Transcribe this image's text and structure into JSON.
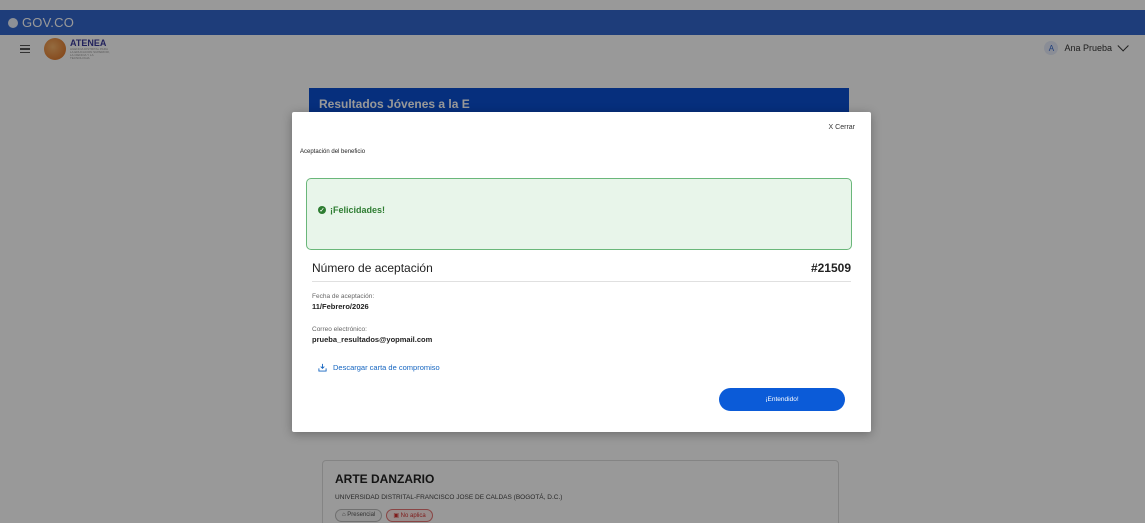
{
  "gov": {
    "brand": "GOV.CO"
  },
  "app": {
    "logo_text": "ATENEA",
    "logo_subtext": "AGENCIA DISTRITAL PARA LA EDUCACION SUPERIOR, LA CIENCIA Y LA TECNOLOGIA",
    "user_initial": "A",
    "user_name": "Ana Prueba"
  },
  "page": {
    "banner_title": "Resultados Jóvenes a la E",
    "card": {
      "title": "ARTE DANZARIO",
      "university": "UNIVERSIDAD DISTRITAL-FRANCISCO JOSE DE CALDAS (BOGOTÁ, D.C.)",
      "chip_modality": "Presencial",
      "chip_status": "No aplica"
    }
  },
  "modal": {
    "close_label": "X Cerrar",
    "heading": "Aceptación del beneficio",
    "success_message": "¡Felicidades!",
    "acceptance_label": "Número de aceptación",
    "acceptance_number": "#21509",
    "date_label": "Fecha de aceptación:",
    "date_value": "11/Febrero/2026",
    "email_label": "Correo electrónico:",
    "email_value": "prueba_resultados@yopmail.com",
    "download_label": "Descargar carta de compromiso",
    "confirm_button": "¡Entendido!"
  },
  "colors": {
    "gov_bar": "#3366cc",
    "banner": "#0b4fd1",
    "success_bg": "#e8f5ea",
    "success_text": "#2e7d32",
    "primary_button": "#0b5bd8"
  }
}
